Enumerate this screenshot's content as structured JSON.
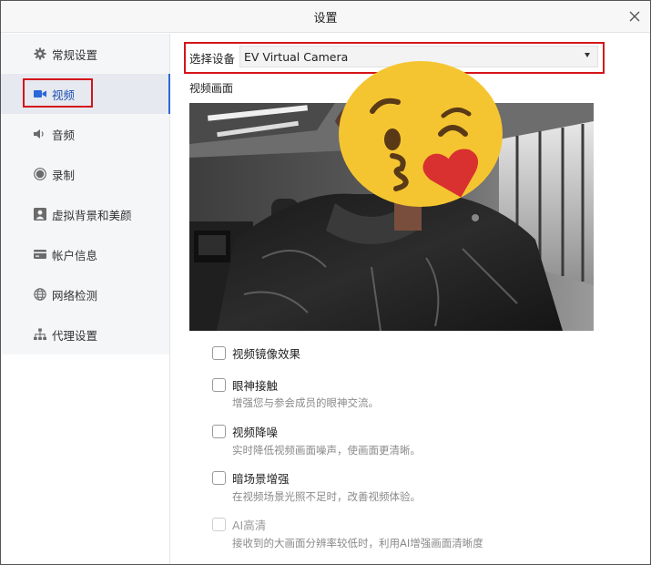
{
  "window": {
    "title": "设置"
  },
  "sidebar": {
    "items": [
      {
        "label": "常规设置",
        "icon": "gear-icon"
      },
      {
        "label": "视频",
        "icon": "video-camera-icon"
      },
      {
        "label": "音频",
        "icon": "speaker-icon"
      },
      {
        "label": "录制",
        "icon": "record-icon"
      },
      {
        "label": "虚拟背景和美颜",
        "icon": "portrait-icon"
      },
      {
        "label": "帐户信息",
        "icon": "wallet-icon"
      },
      {
        "label": "网络检测",
        "icon": "globe-icon"
      },
      {
        "label": "代理设置",
        "icon": "network-tree-icon"
      }
    ],
    "active_index": 1
  },
  "device": {
    "label": "选择设备",
    "selected": "EV Virtual Camera"
  },
  "preview": {
    "label": "视频画面"
  },
  "options": [
    {
      "label": "视频镜像效果",
      "checked": false,
      "disabled": false
    },
    {
      "label": "眼神接触",
      "desc": "增强您与参会成员的眼神交流。",
      "checked": false,
      "disabled": false
    },
    {
      "label": "视频降噪",
      "desc": "实时降低视频画面噪声，使画面更清晰。",
      "checked": false,
      "disabled": false
    },
    {
      "label": "暗场景增强",
      "desc": "在视频场景光照不足时，改善视频体验。",
      "checked": false,
      "disabled": false
    },
    {
      "label": "AI高清",
      "desc": "接收到的大画面分辨率较低时，利用AI增强画面清晰度",
      "checked": false,
      "disabled": true
    }
  ],
  "colors": {
    "accent": "#2b67d9",
    "highlight_box": "#d4151a",
    "emoji_face": "#f5c531",
    "emoji_heart": "#d8312f"
  }
}
